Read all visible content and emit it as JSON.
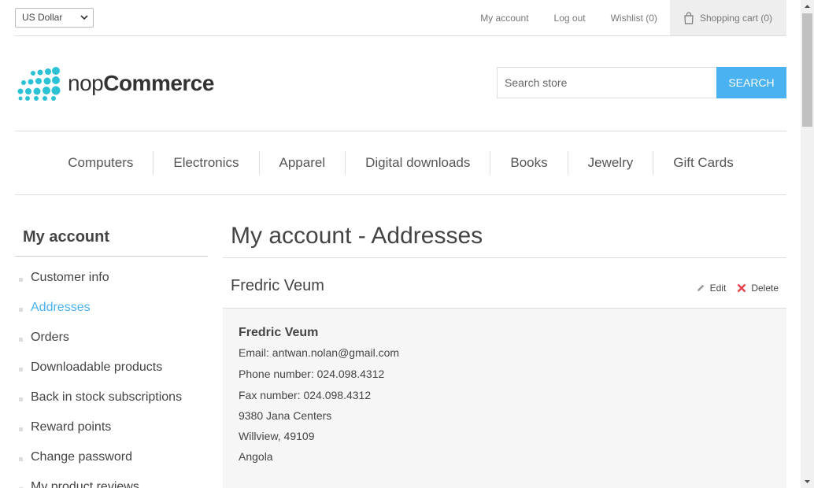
{
  "header": {
    "currency": "US Dollar",
    "links": [
      "My account",
      "Log out",
      "Wishlist (0)"
    ],
    "cart": "Shopping cart (0)"
  },
  "logo": {
    "light": "nop",
    "bold": "Commerce"
  },
  "search": {
    "placeholder": "Search store",
    "button": "SEARCH"
  },
  "menu": [
    "Computers",
    "Electronics",
    "Apparel",
    "Digital downloads",
    "Books",
    "Jewelry",
    "Gift Cards"
  ],
  "sidebar": {
    "title": "My account",
    "items": [
      "Customer info",
      "Addresses",
      "Orders",
      "Downloadable products",
      "Back in stock subscriptions",
      "Reward points",
      "Change password",
      "My product reviews"
    ],
    "active_index": 1
  },
  "main": {
    "title": "My account - Addresses",
    "address": {
      "header_name": "Fredric Veum",
      "edit": "Edit",
      "delete": "Delete",
      "name": "Fredric Veum",
      "email": "Email: antwan.nolan@gmail.com",
      "phone": "Phone number: 024.098.4312",
      "fax": "Fax number: 024.098.4312",
      "street": "9380 Jana Centers",
      "city": "Willview, 49109",
      "country": "Angola"
    }
  },
  "colors": {
    "accent": "#4ab2f1",
    "delete": "#e4434b",
    "logo_dots": "#2dc1d6"
  }
}
